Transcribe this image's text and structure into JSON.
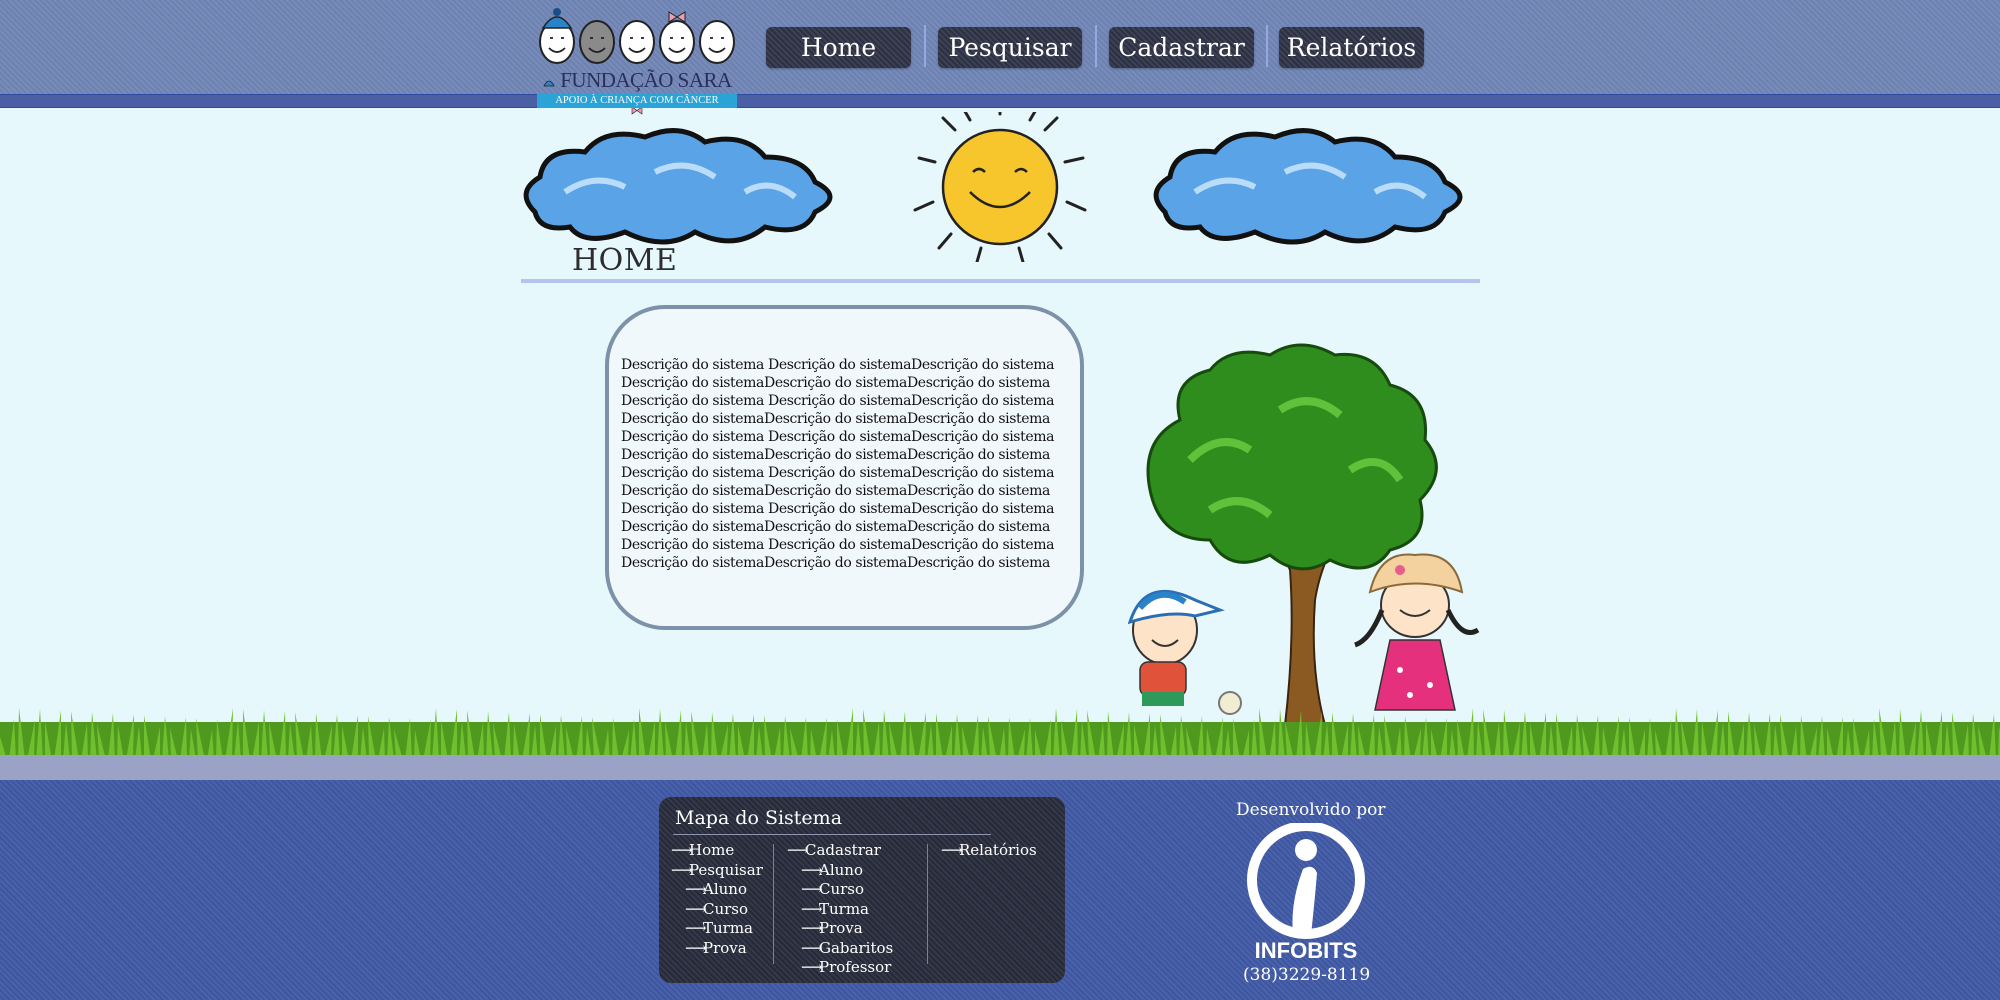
{
  "logo": {
    "name": "FUNDAÇÃO SARA",
    "tagline": "APOIO À CRIANÇA COM CÂNCER"
  },
  "nav": {
    "items": [
      {
        "label": "Home"
      },
      {
        "label": "Pesquisar"
      },
      {
        "label": "Cadastrar"
      },
      {
        "label": "Relatórios"
      }
    ]
  },
  "main": {
    "title": "HOME",
    "description": "Descrição do sistema Descrição do sistemaDescrição do sistema\nDescrição do sistemaDescrição do sistemaDescrição do sistema\nDescrição do sistema Descrição do sistemaDescrição do sistema\nDescrição do sistemaDescrição do sistemaDescrição do sistema\nDescrição do sistema Descrição do sistemaDescrição do sistema\nDescrição do sistemaDescrição do sistemaDescrição do sistema\nDescrição do sistema Descrição do sistemaDescrição do sistema\nDescrição do sistemaDescrição do sistemaDescrição do sistema\nDescrição do sistema Descrição do sistemaDescrição do sistema\nDescrição do sistemaDescrição do sistemaDescrição do sistema\nDescrição do sistema Descrição do sistemaDescrição do sistema\nDescrição do sistemaDescrição do sistemaDescrição do sistema"
  },
  "sitemap": {
    "title": "Mapa do Sistema",
    "arrow": "⟶",
    "col1": {
      "home": "Home",
      "pesquisar": "Pesquisar",
      "sub": [
        "Aluno",
        "Curso",
        "Turma",
        "Prova"
      ]
    },
    "col2": {
      "cadastrar": "Cadastrar",
      "sub": [
        "Aluno",
        "Curso",
        "Turma",
        "Prova",
        "Gabaritos",
        "Professor"
      ]
    },
    "col3": {
      "relatorios": "Relatórios"
    }
  },
  "footer": {
    "developed_by": "Desenvolvido por",
    "company": "INFOBITS",
    "phone": "(38)3229-8119"
  },
  "colors": {
    "header": "#7186b7",
    "nav_button": "#2e3346",
    "sky": "#e7f8fd",
    "footer": "#3f5aa5",
    "grass": "#4f9a1e"
  }
}
